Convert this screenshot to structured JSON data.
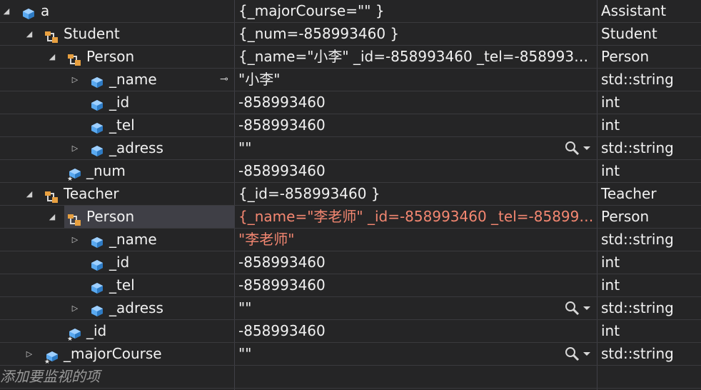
{
  "watch": {
    "rows": [
      {
        "name": "a",
        "value": "{_majorCourse=\"\" }",
        "type": "Assistant"
      },
      {
        "name": "Student",
        "value": "{_num=-858993460 }",
        "type": "Student"
      },
      {
        "name": "Person",
        "value": "{_name=\"小李\" _id=-858993460 _tel=-85899346…",
        "type": "Person"
      },
      {
        "name": "_name",
        "value": "\"小李\"",
        "type": "std::string"
      },
      {
        "name": "_id",
        "value": "-858993460",
        "type": "int"
      },
      {
        "name": "_tel",
        "value": "-858993460",
        "type": "int"
      },
      {
        "name": "_adress",
        "value": "\"\"",
        "type": "std::string"
      },
      {
        "name": "_num",
        "value": "-858993460",
        "type": "int"
      },
      {
        "name": "Teacher",
        "value": "{_id=-858993460 }",
        "type": "Teacher"
      },
      {
        "name": "Person",
        "value": "{_name=\"李老师\" _id=-858993460 _tel=-858993…",
        "type": "Person"
      },
      {
        "name": "_name",
        "value": "\"李老师\"",
        "type": "std::string"
      },
      {
        "name": "_id",
        "value": "-858993460",
        "type": "int"
      },
      {
        "name": "_tel",
        "value": "-858993460",
        "type": "int"
      },
      {
        "name": "_adress",
        "value": "\"\"",
        "type": "std::string"
      },
      {
        "name": "_id",
        "value": "-858993460",
        "type": "int"
      },
      {
        "name": "_majorCourse",
        "value": "\"\"",
        "type": "std::string"
      }
    ],
    "add_item_placeholder": "添加要监视的项"
  },
  "colors": {
    "changed_value": "#f48771",
    "field_icon": "#5aa9f0",
    "base_icon": "#e8a040",
    "background": "#252526"
  },
  "icons": {
    "field": "field-icon",
    "static_field": "static-field-icon",
    "base_class": "base-class-icon",
    "pin": "pin-icon",
    "magnifier": "magnifier-icon",
    "dropdown": "dropdown-arrow-icon"
  }
}
